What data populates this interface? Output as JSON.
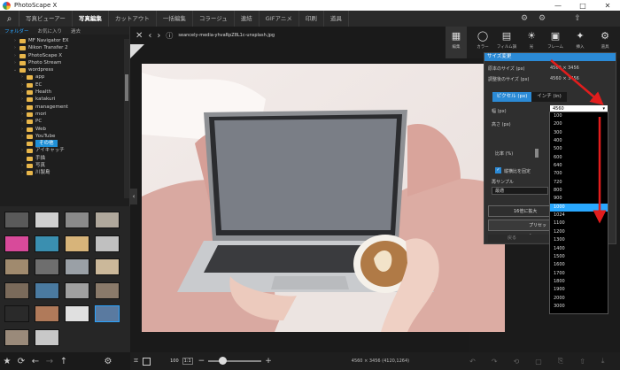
{
  "app": {
    "title": "PhotoScape X",
    "window_buttons": [
      "—",
      "□",
      "✕"
    ]
  },
  "menu": {
    "home_icon": "search-icon",
    "tabs": [
      {
        "label": "写真ビューアー",
        "active": false
      },
      {
        "label": "写真編集",
        "active": true
      },
      {
        "label": "カットアウト",
        "active": false
      },
      {
        "label": "一括編集",
        "active": false
      },
      {
        "label": "コラージュ",
        "active": false
      },
      {
        "label": "連結",
        "active": false
      },
      {
        "label": "GIFアニメ",
        "active": false
      },
      {
        "label": "印刷",
        "active": false
      },
      {
        "label": "道具",
        "active": false
      }
    ]
  },
  "left": {
    "tabs": [
      "フォルダー",
      "お気に入り",
      "過去"
    ],
    "tree": [
      {
        "label": "MF Navigator EX",
        "depth": 1,
        "arrow": "›"
      },
      {
        "label": "Nikon Transfer 2",
        "depth": 1,
        "arrow": "›"
      },
      {
        "label": "PhotoScape X",
        "depth": 1,
        "arrow": "›"
      },
      {
        "label": "Photo Stream",
        "depth": 1,
        "arrow": "›"
      },
      {
        "label": "wordpress",
        "depth": 1,
        "arrow": "⌄"
      },
      {
        "label": "app",
        "depth": 2,
        "arrow": "›"
      },
      {
        "label": "EC",
        "depth": 2,
        "arrow": "›"
      },
      {
        "label": "Health",
        "depth": 2,
        "arrow": "›"
      },
      {
        "label": "katakuri",
        "depth": 2,
        "arrow": "›"
      },
      {
        "label": "management",
        "depth": 2,
        "arrow": "›"
      },
      {
        "label": "mori",
        "depth": 2,
        "arrow": "›"
      },
      {
        "label": "PC",
        "depth": 2,
        "arrow": "›"
      },
      {
        "label": "Web",
        "depth": 2,
        "arrow": "›"
      },
      {
        "label": "YouTube",
        "depth": 2,
        "arrow": "›"
      },
      {
        "label": "その他",
        "depth": 2,
        "arrow": "",
        "selected": true
      },
      {
        "label": "アイキャッチ",
        "depth": 2,
        "arrow": "›"
      },
      {
        "label": "手描",
        "depth": 2,
        "arrow": ""
      },
      {
        "label": "写真",
        "depth": 2,
        "arrow": "›"
      },
      {
        "label": "川製島",
        "depth": 2,
        "arrow": "›"
      }
    ],
    "bottom_icons": [
      "star-icon",
      "refresh-icon",
      "back-icon",
      "forward-icon",
      "up-icon"
    ]
  },
  "viewer": {
    "filename": "seancely-media-yhvaRpZ8L1c-unsplash.jpg",
    "zoom_label": "100",
    "zoom_btn": "1:1",
    "dimensions": "4560 × 3456 (4120,1264)",
    "badge": "NEW"
  },
  "tools": [
    {
      "label": "編集",
      "icon": "edit-icon",
      "active": true
    },
    {
      "label": "カラー",
      "icon": "circle-icon"
    },
    {
      "label": "フィルム調",
      "icon": "film-icon"
    },
    {
      "label": "光",
      "icon": "sun-icon"
    },
    {
      "label": "フレーム",
      "icon": "frame-icon"
    },
    {
      "label": "挿入",
      "icon": "insert-icon"
    },
    {
      "label": "道具",
      "icon": "tools-icon"
    }
  ],
  "dialog": {
    "title": "サイズ変更",
    "original_size_label": "原本のサイズ (px)",
    "original_size_value": "4560 × 3456",
    "adjusted_size_label": "調整後のサイズ (px)",
    "adjusted_size_value": "4560 × 3456",
    "tab_pixel": "ピクセル (px)",
    "tab_inch": "インチ (in)",
    "width_label": "幅 (px)",
    "width_value": "4560",
    "height_label": "高さ (px)",
    "ratio_label": "比率 (%)",
    "keep_ratio_label": "縦横比を固定",
    "resample_label": "再サンプル",
    "resample_value": "最適",
    "button_label": "16倍に拡大",
    "preset_label": "プリセット",
    "cancel_label": "戻る"
  },
  "dropdown": {
    "options": [
      "100",
      "200",
      "300",
      "400",
      "500",
      "600",
      "640",
      "700",
      "720",
      "800",
      "900",
      "1000",
      "1024",
      "1100",
      "1200",
      "1300",
      "1400",
      "1500",
      "1600",
      "1700",
      "1800",
      "1900",
      "2000",
      "3000"
    ],
    "highlighted": "1000"
  },
  "colors": {
    "accent": "#2b8ad6",
    "highlight": "#29a8ff",
    "arrow": "#e21d1d"
  }
}
